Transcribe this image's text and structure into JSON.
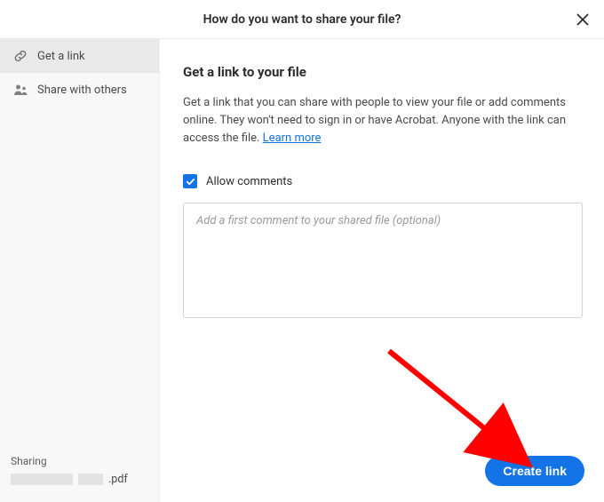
{
  "header": {
    "title": "How do you want to share your file?"
  },
  "sidebar": {
    "items": [
      {
        "label": "Get a link"
      },
      {
        "label": "Share with others"
      }
    ],
    "sharing_label": "Sharing",
    "file_ext": ".pdf"
  },
  "main": {
    "title": "Get a link to your file",
    "description_pre": "Get a link that you can share with people to view your file or add comments online. They won't need to sign in or have Acrobat. Anyone with the link can access the file. ",
    "learn_more": "Learn more",
    "allow_comments_label": "Allow comments",
    "comment_placeholder": "Add a first comment to your shared file (optional)",
    "cta_label": "Create link"
  },
  "colors": {
    "accent": "#1473e6"
  }
}
